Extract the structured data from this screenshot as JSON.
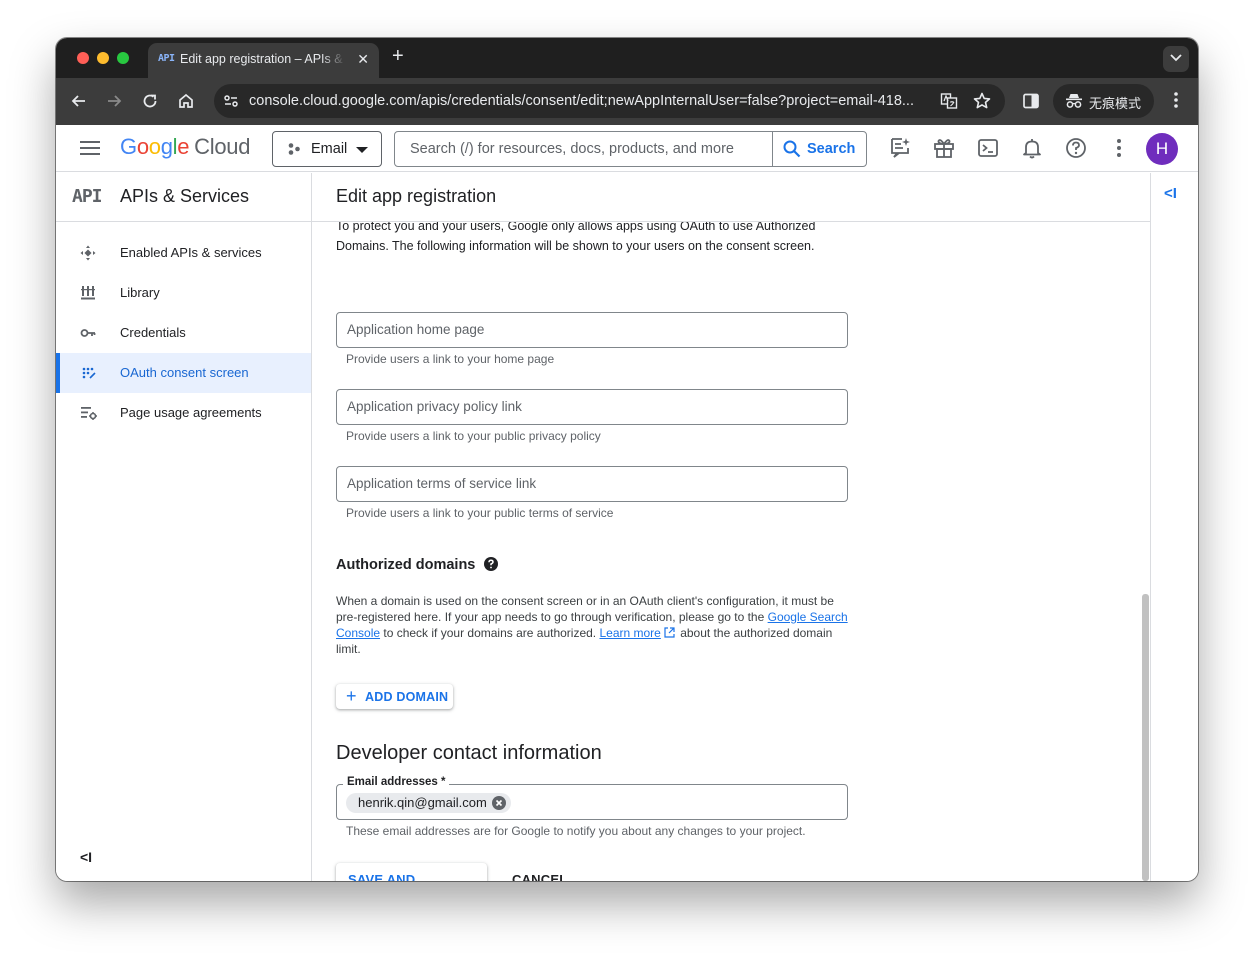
{
  "browser": {
    "tab": {
      "favicon_text": "API",
      "title": "Edit app registration – APIs & Services – Email",
      "close": "✕"
    },
    "new_tab": "+",
    "omnibox": {
      "url": "console.cloud.google.com/apis/credentials/consent/edit;newAppInternalUser=false?project=email-418..."
    },
    "incognito_label": "无痕模式"
  },
  "header": {
    "logo": {
      "g1": "G",
      "o1": "o",
      "o2": "o",
      "g2": "g",
      "l": "l",
      "e": "e",
      "cloud": "Cloud"
    },
    "project_name": "Email",
    "search_placeholder": "Search (/) for resources, docs, products, and more",
    "search_button": "Search",
    "avatar_initial": "H"
  },
  "sidebar": {
    "logo_text": "API",
    "title": "APIs & Services",
    "items": [
      {
        "label": "Enabled APIs & services",
        "icon": "enabled-apis-icon",
        "active": false
      },
      {
        "label": "Library",
        "icon": "library-icon",
        "active": false
      },
      {
        "label": "Credentials",
        "icon": "key-icon",
        "active": false
      },
      {
        "label": "OAuth consent screen",
        "icon": "oauth-icon",
        "active": true
      },
      {
        "label": "Page usage agreements",
        "icon": "settings-list-icon",
        "active": false
      }
    ],
    "collapse": "<I"
  },
  "main": {
    "title": "Edit app registration",
    "intro_text": "To protect you and your users, Google only allows apps using OAuth to use Authorized Domains. The following information will be shown to your users on the consent screen.",
    "fields": [
      {
        "label": "Application home page",
        "hint": "Provide users a link to your home page"
      },
      {
        "label": "Application privacy policy link",
        "hint": "Provide users a link to your public privacy policy"
      },
      {
        "label": "Application terms of service link",
        "hint": "Provide users a link to your public terms of service"
      }
    ],
    "authorized_domains": {
      "title": "Authorized domains",
      "text_1": "When a domain is used on the consent screen or in an OAuth client's configuration, it must be pre-registered here. If your app needs to go through verification, please go to the ",
      "link_1": "Google Search Console",
      "text_2": " to check if your domains are authorized. ",
      "link_2": "Learn more",
      "text_3": " about the authorized domain limit.",
      "add_button": "ADD DOMAIN",
      "add_plus": "+"
    },
    "developer_contact": {
      "title": "Developer contact information",
      "email_label": "Email addresses *",
      "email_chip": "henrik.qin@gmail.com",
      "hint": "These email addresses are for Google to notify you about any changes to your project."
    },
    "save_button": "SAVE AND CONTINUE",
    "cancel_button": "CANCEL"
  },
  "right_panel": {
    "collapse": "<I"
  },
  "colors": {
    "accent_blue": "#1a73e8",
    "active_nav_bg": "#e8f0fe",
    "avatar_bg": "#6f2dbd",
    "chrome_dark": "#3c3c3c"
  }
}
